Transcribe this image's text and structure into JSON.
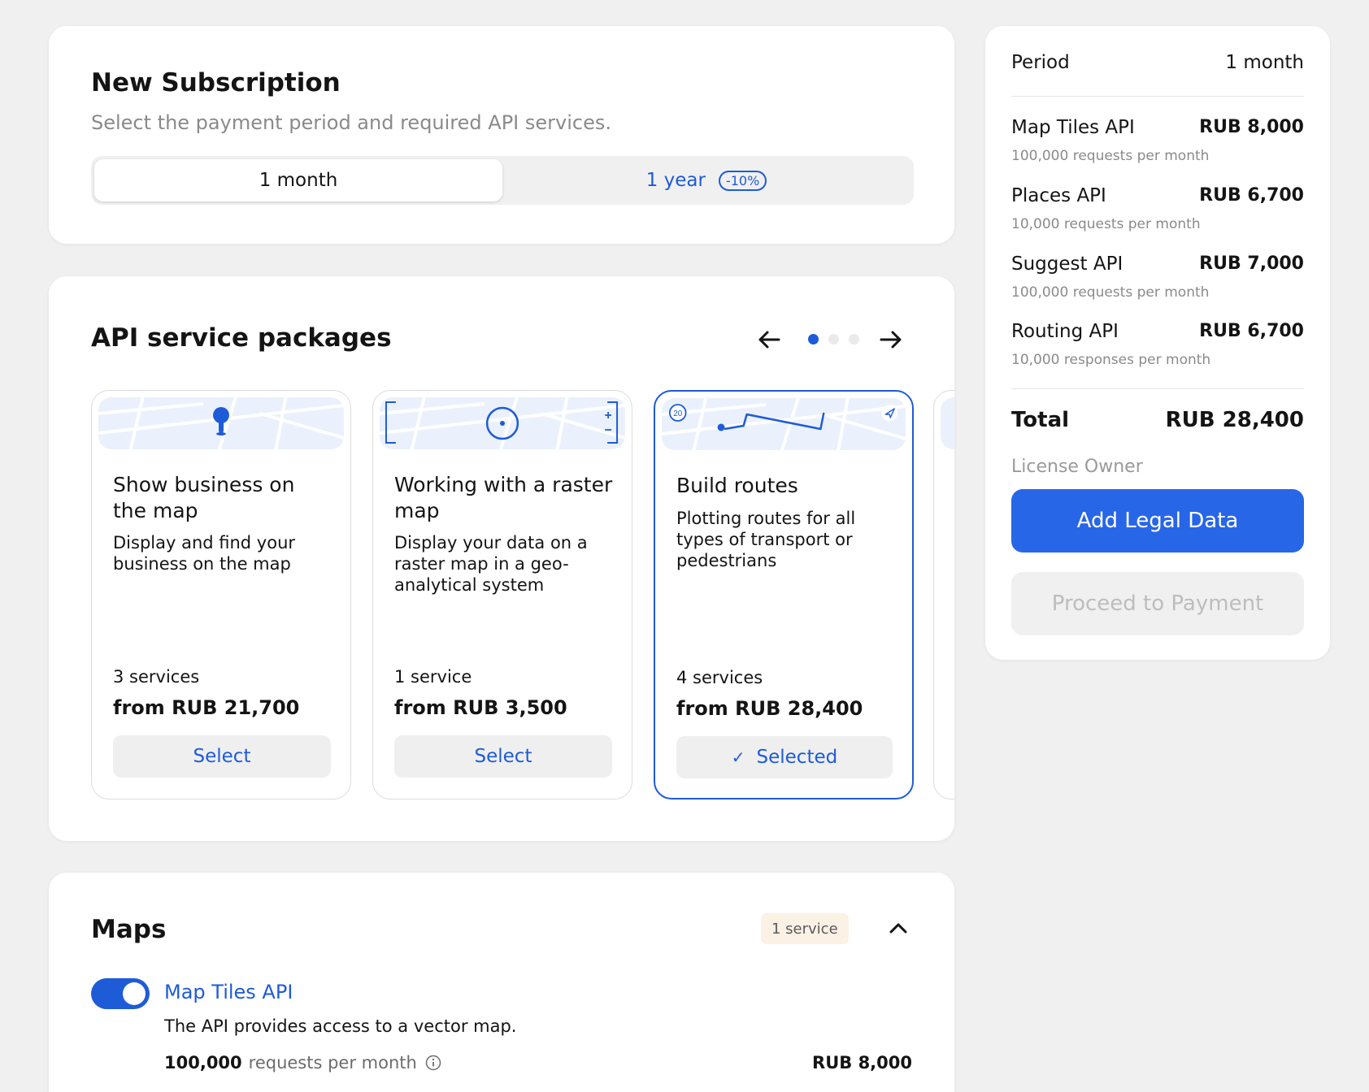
{
  "subscription": {
    "title": "New Subscription",
    "subtitle": "Select the payment period and required API services.",
    "period_options": [
      {
        "label": "1 month",
        "selected": true
      },
      {
        "label": "1 year",
        "discount": "-10%",
        "selected": false
      }
    ]
  },
  "packages": {
    "title": "API service packages",
    "pager": {
      "current": 1,
      "total": 3
    },
    "items": [
      {
        "title": "Show business on the map",
        "description": "Display and find your business on the map",
        "count": "3 services",
        "price": "from RUB 21,700",
        "button": "Select",
        "selected": false
      },
      {
        "title": "Working with a raster map",
        "description": "Display your data on a raster map in a geo-analytical system",
        "count": "1 service",
        "price": "from RUB 3,500",
        "button": "Select",
        "selected": false
      },
      {
        "title": "Build routes",
        "description": "Plotting routes for all types of transport or pedestrians",
        "count": "4 services",
        "price": "from RUB 28,400",
        "button": "Selected",
        "selected": true,
        "route_badge": "20"
      }
    ]
  },
  "maps": {
    "title": "Maps",
    "badge": "1 service",
    "service": {
      "name": "Map Tiles API",
      "enabled": true,
      "description": "The API provides access to a vector map.",
      "quota_value": "100,000",
      "quota_unit": "requests per month",
      "price": "RUB 8,000"
    }
  },
  "summary": {
    "period_label": "Period",
    "period_value": "1 month",
    "lines": [
      {
        "name": "Map Tiles API",
        "price": "RUB 8,000",
        "quota": "100,000 requests per month"
      },
      {
        "name": "Places API",
        "price": "RUB 6,700",
        "quota": "10,000 requests per month"
      },
      {
        "name": "Suggest API",
        "price": "RUB 7,000",
        "quota": "100,000 requests per month"
      },
      {
        "name": "Routing API",
        "price": "RUB 6,700",
        "quota": "10,000 responses per month"
      }
    ],
    "total_label": "Total",
    "total_value": "RUB 28,400",
    "owner_label": "License Owner",
    "add_legal_button": "Add Legal Data",
    "proceed_button": "Proceed to Payment"
  },
  "colors": {
    "accent": "#1e5bd7",
    "primary_button": "#2866e8",
    "badge_bg": "#fbf1e4"
  }
}
